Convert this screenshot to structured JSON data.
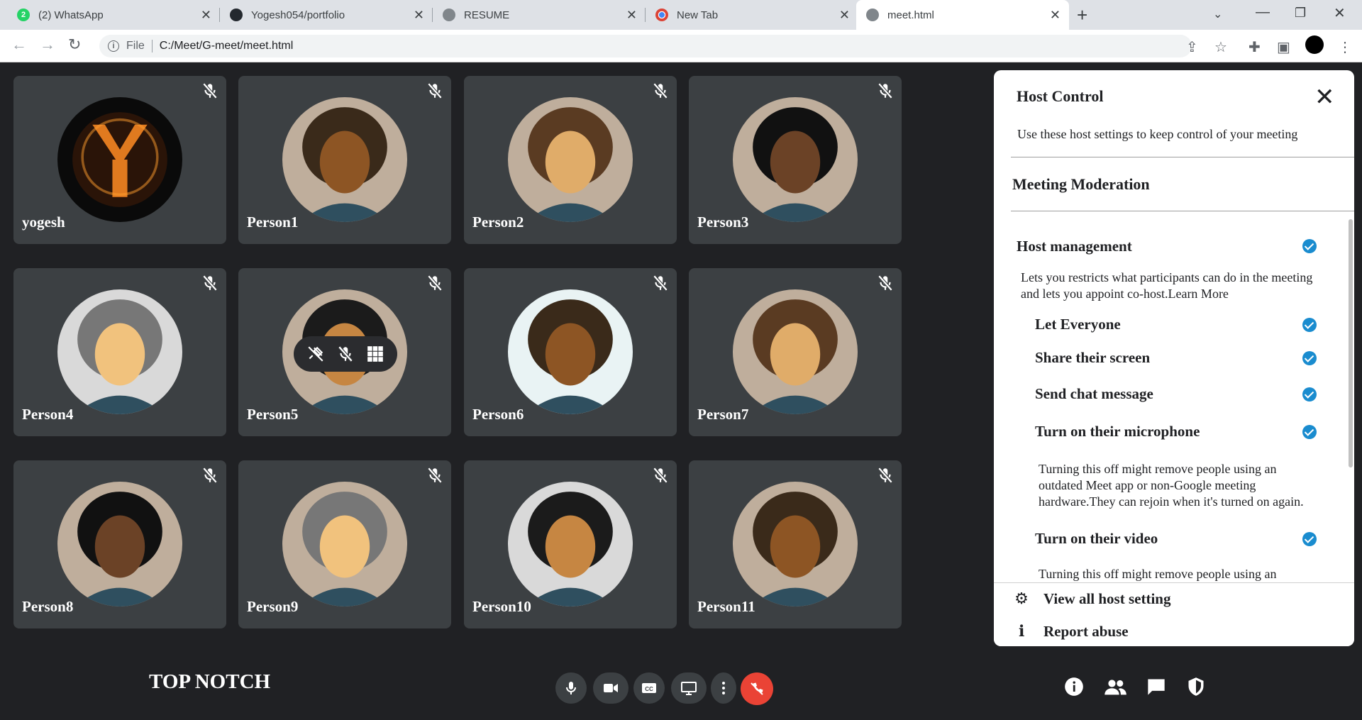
{
  "browser": {
    "tabs": [
      {
        "title": "(2) WhatsApp",
        "favicon": "whatsapp-icon",
        "color": "#25d366",
        "badge": "2"
      },
      {
        "title": "Yogesh054/portfolio",
        "favicon": "github-icon",
        "color": "#24292f",
        "badge": ""
      },
      {
        "title": "RESUME",
        "favicon": "globe-icon",
        "color": "#5f6368",
        "badge": ""
      },
      {
        "title": "New Tab",
        "favicon": "chrome-icon",
        "color": "#5f6368",
        "badge": ""
      },
      {
        "title": "meet.html",
        "favicon": "globe-icon",
        "color": "#5f6368",
        "badge": ""
      }
    ],
    "address": {
      "scheme": "File",
      "path": "C:/Meet/G-meet/meet.html"
    }
  },
  "participants": [
    {
      "name": "yogesh"
    },
    {
      "name": "Person1"
    },
    {
      "name": "Person2"
    },
    {
      "name": "Person3"
    },
    {
      "name": "Person4"
    },
    {
      "name": "Person5"
    },
    {
      "name": "Person6"
    },
    {
      "name": "Person7"
    },
    {
      "name": "Person8"
    },
    {
      "name": "Person9"
    },
    {
      "name": "Person10"
    },
    {
      "name": "Person11"
    }
  ],
  "host_panel": {
    "title": "Host Control",
    "subtitle": "Use these host settings to keep control of your meeting",
    "section": "Meeting Moderation",
    "host_management": {
      "label": "Host management",
      "description_line1": "Lets you restricts what participants can do in the meeting",
      "description_line2": "and lets you appoint co-host.Learn More"
    },
    "options": [
      {
        "label": "Let Everyone",
        "checked": true
      },
      {
        "label": "Share their screen",
        "checked": true
      },
      {
        "label": "Send chat message",
        "checked": true
      },
      {
        "label": "Turn on their microphone",
        "checked": true
      },
      {
        "label": "Turn on their video",
        "checked": true
      }
    ],
    "mic_note": [
      "Turning this off might remove people using an",
      "outdated Meet app or non-Google meeting",
      "hardware.They can rejoin when it's turned on again."
    ],
    "video_note_partial": "Turning this off might remove people using an",
    "footer": {
      "view_all": "View all host setting",
      "report": "Report abuse"
    },
    "accent_color": "#1a8ccf"
  },
  "bottom_bar": {
    "brand": "TOP NOTCH",
    "end_call_color": "#ea4335"
  }
}
